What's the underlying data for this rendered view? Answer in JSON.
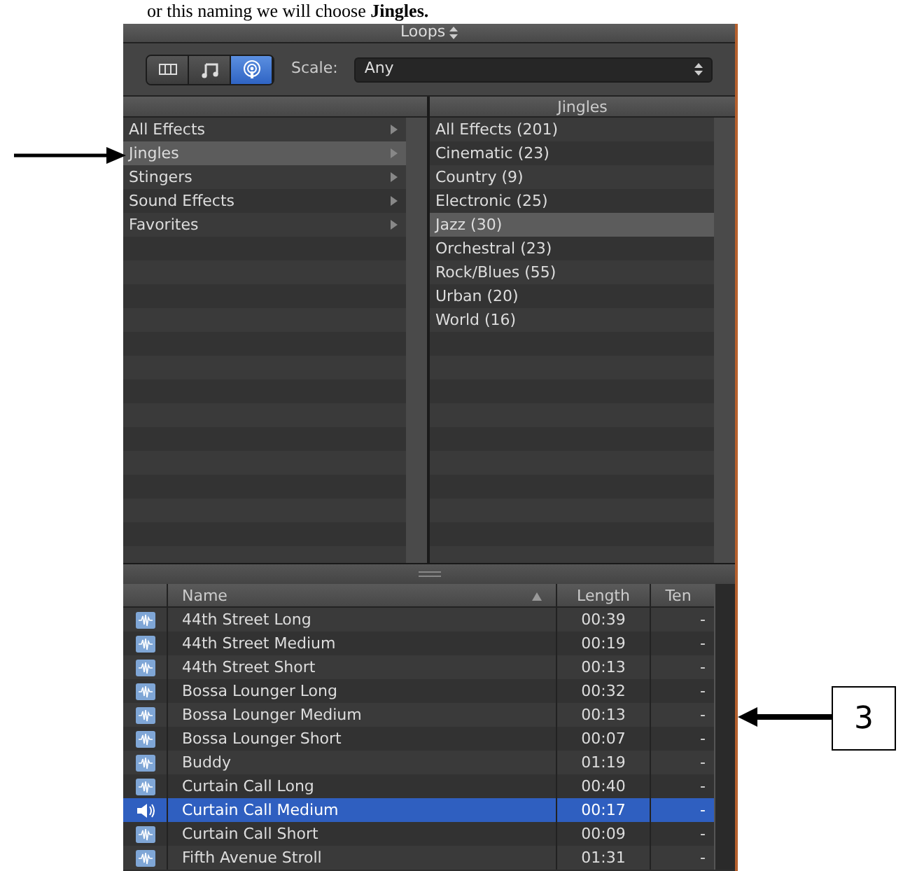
{
  "caption": "or this naming we will choose **Jingles.**",
  "header": {
    "title": "Loops"
  },
  "view_buttons": [
    {
      "kind": "columns",
      "selected": false
    },
    {
      "kind": "note",
      "selected": false
    },
    {
      "kind": "podcast",
      "selected": true
    }
  ],
  "scale": {
    "label": "Scale:",
    "value": "Any"
  },
  "categories": [
    {
      "label": "All Effects",
      "selected": false
    },
    {
      "label": "Jingles",
      "selected": true
    },
    {
      "label": "Stingers",
      "selected": false
    },
    {
      "label": "Sound Effects",
      "selected": false
    },
    {
      "label": "Favorites",
      "selected": false
    }
  ],
  "subcategories_title": "Jingles",
  "subcategories": [
    {
      "label": "All Effects (201)",
      "selected": false
    },
    {
      "label": "Cinematic (23)",
      "selected": false
    },
    {
      "label": "Country (9)",
      "selected": false
    },
    {
      "label": "Electronic (25)",
      "selected": false
    },
    {
      "label": "Jazz (30)",
      "selected": true
    },
    {
      "label": "Orchestral (23)",
      "selected": false
    },
    {
      "label": "Rock/Blues (55)",
      "selected": false
    },
    {
      "label": "Urban (20)",
      "selected": false
    },
    {
      "label": "World (16)",
      "selected": false
    }
  ],
  "table": {
    "columns": [
      "Name",
      "Length",
      "Ten"
    ],
    "rows": [
      {
        "kind": "loop",
        "name": "44th Street Long",
        "length": "00:39",
        "tempo": "-",
        "selected": false
      },
      {
        "kind": "loop",
        "name": "44th Street Medium",
        "length": "00:19",
        "tempo": "-",
        "selected": false
      },
      {
        "kind": "loop",
        "name": "44th Street Short",
        "length": "00:13",
        "tempo": "-",
        "selected": false
      },
      {
        "kind": "loop",
        "name": "Bossa Lounger Long",
        "length": "00:32",
        "tempo": "-",
        "selected": false
      },
      {
        "kind": "loop",
        "name": "Bossa Lounger Medium",
        "length": "00:13",
        "tempo": "-",
        "selected": false
      },
      {
        "kind": "loop",
        "name": "Bossa Lounger Short",
        "length": "00:07",
        "tempo": "-",
        "selected": false
      },
      {
        "kind": "loop",
        "name": "Buddy",
        "length": "01:19",
        "tempo": "-",
        "selected": false
      },
      {
        "kind": "loop",
        "name": "Curtain Call Long",
        "length": "00:40",
        "tempo": "-",
        "selected": false
      },
      {
        "kind": "playing",
        "name": "Curtain Call Medium",
        "length": "00:17",
        "tempo": "-",
        "selected": true
      },
      {
        "kind": "loop",
        "name": "Curtain Call Short",
        "length": "00:09",
        "tempo": "-",
        "selected": false
      },
      {
        "kind": "loop",
        "name": "Fifth Avenue Stroll",
        "length": "01:31",
        "tempo": "-",
        "selected": false
      }
    ]
  },
  "callout": {
    "label": "3"
  }
}
